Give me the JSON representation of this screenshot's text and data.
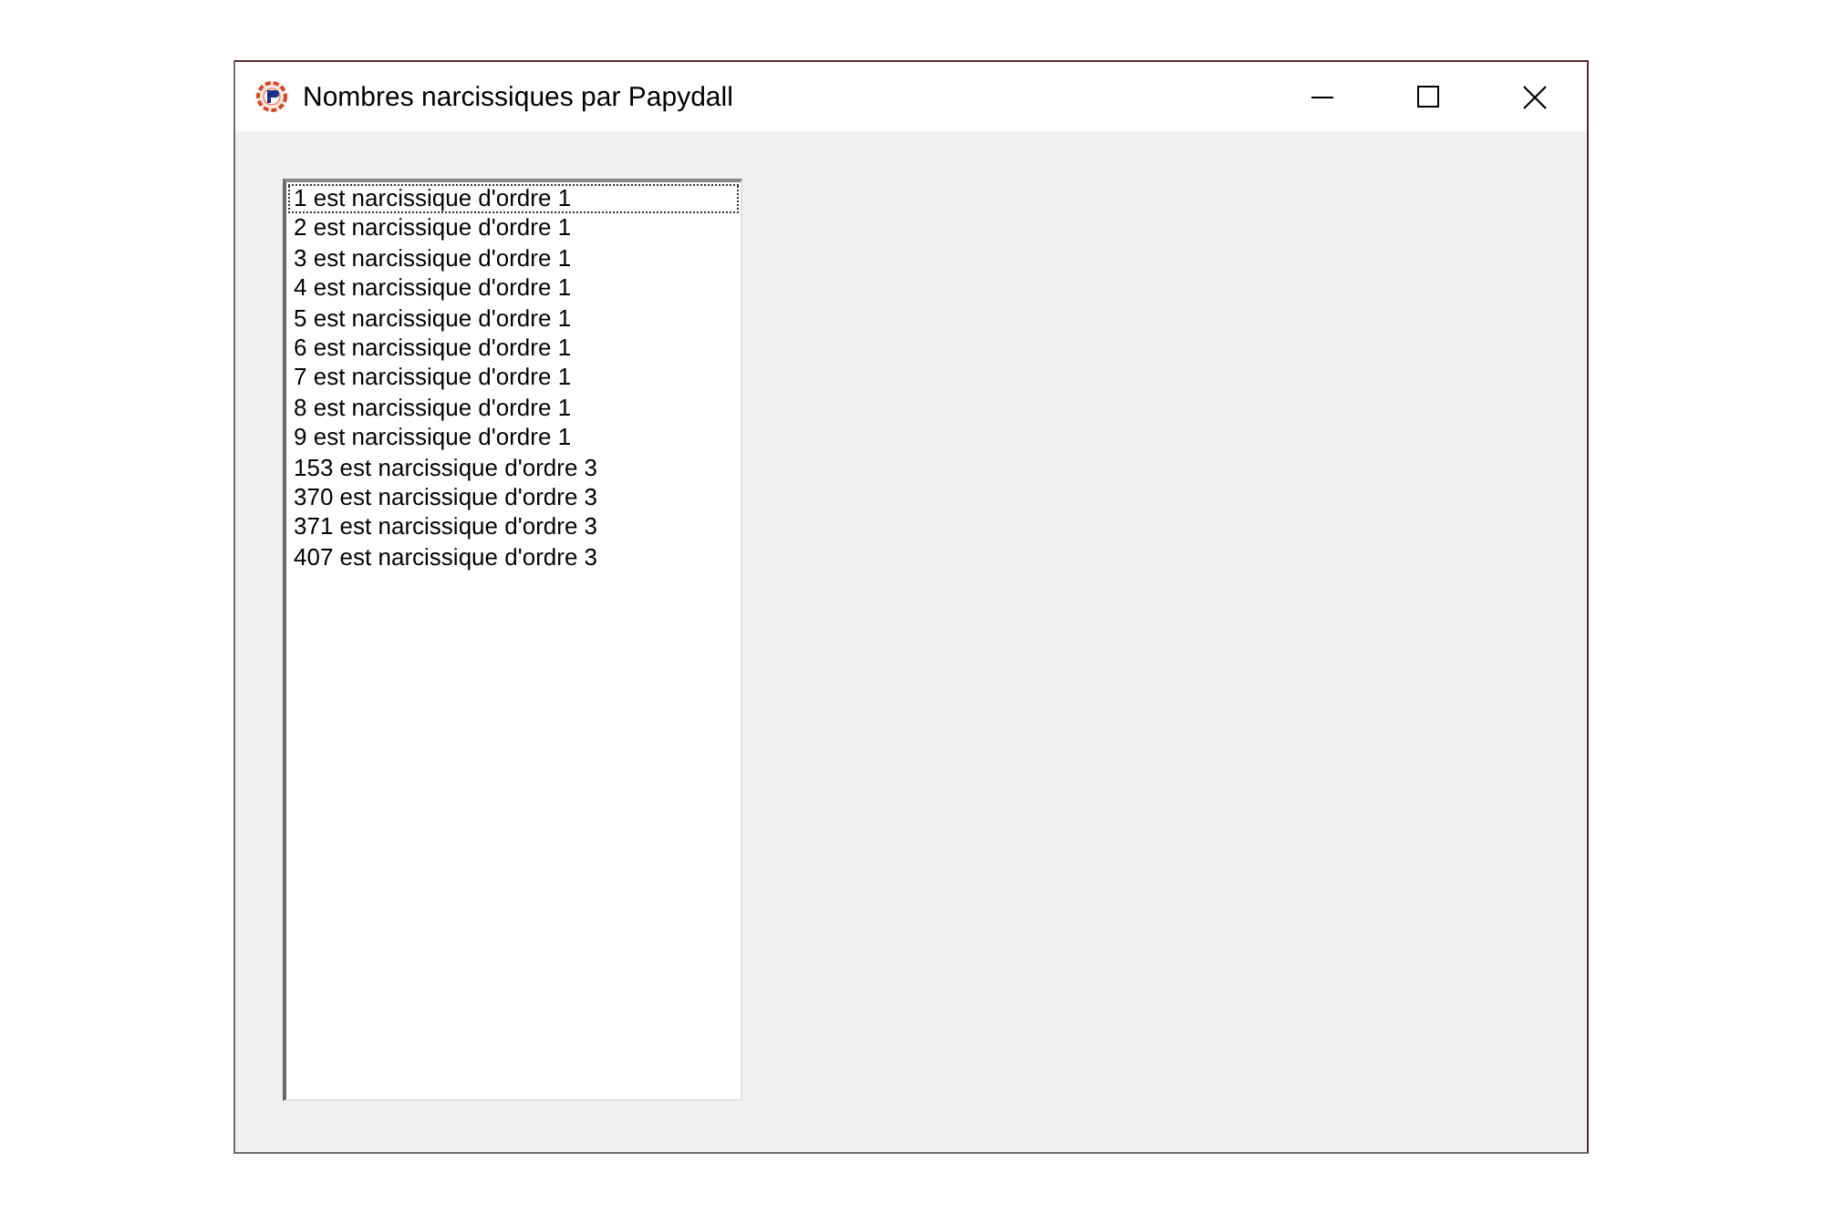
{
  "window": {
    "title": "Nombres narcissiques par Papydall"
  },
  "listbox": {
    "items": [
      {
        "text": "1 est narcissique d'ordre 1",
        "focused": true
      },
      {
        "text": "2 est narcissique d'ordre 1",
        "focused": false
      },
      {
        "text": "3 est narcissique d'ordre 1",
        "focused": false
      },
      {
        "text": "4 est narcissique d'ordre 1",
        "focused": false
      },
      {
        "text": "5 est narcissique d'ordre 1",
        "focused": false
      },
      {
        "text": "6 est narcissique d'ordre 1",
        "focused": false
      },
      {
        "text": "7 est narcissique d'ordre 1",
        "focused": false
      },
      {
        "text": "8 est narcissique d'ordre 1",
        "focused": false
      },
      {
        "text": "9 est narcissique d'ordre 1",
        "focused": false
      },
      {
        "text": "153 est narcissique d'ordre 3",
        "focused": false
      },
      {
        "text": "370 est narcissique d'ordre 3",
        "focused": false
      },
      {
        "text": "371 est narcissique d'ordre 3",
        "focused": false
      },
      {
        "text": "407 est narcissique d'ordre 3",
        "focused": false
      }
    ]
  }
}
